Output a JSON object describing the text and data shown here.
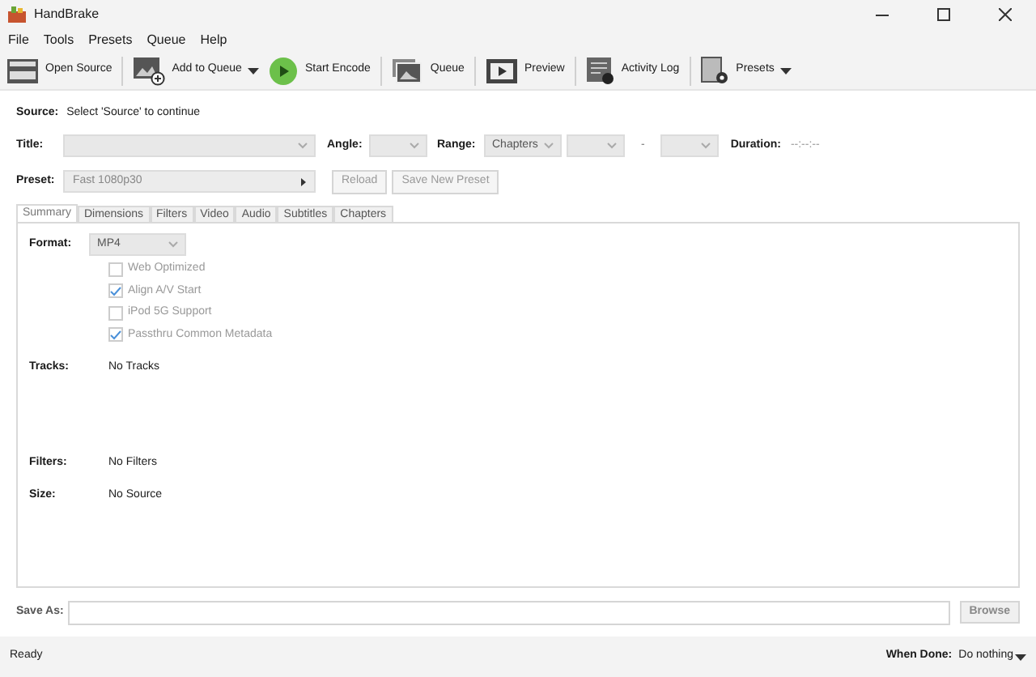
{
  "window": {
    "title": "HandBrake"
  },
  "menu": [
    "File",
    "Tools",
    "Presets",
    "Queue",
    "Help"
  ],
  "toolbar": [
    {
      "kind": "clapper",
      "label": "Open Source",
      "dropdown": false
    },
    {
      "kind": "add",
      "label": "Add to Queue",
      "dropdown": true
    },
    {
      "kind": "play",
      "label": "Start Encode",
      "dropdown": false
    },
    {
      "kind": "queue",
      "label": "Queue",
      "dropdown": false
    },
    {
      "kind": "film",
      "label": "Preview",
      "dropdown": false
    },
    {
      "kind": "log",
      "label": "Activity Log",
      "dropdown": false
    },
    {
      "kind": "presets",
      "label": "Presets",
      "dropdown": true
    }
  ],
  "source": {
    "label": "Source:",
    "value": "Select 'Source' to continue"
  },
  "title_row": {
    "title_label": "Title:",
    "angle_label": "Angle:",
    "range_label": "Range:",
    "range_value": "Chapters",
    "range_separator": "-",
    "duration_label": "Duration:",
    "duration_value": "--:--:--"
  },
  "preset": {
    "label": "Preset:",
    "value": "Fast 1080p30",
    "buttons": [
      "Reload",
      "Save New Preset"
    ]
  },
  "tabs": [
    {
      "label": "Summary",
      "selected": true
    },
    {
      "label": "Dimensions",
      "selected": false
    },
    {
      "label": "Filters",
      "selected": false
    },
    {
      "label": "Video",
      "selected": false
    },
    {
      "label": "Audio",
      "selected": false
    },
    {
      "label": "Subtitles",
      "selected": false
    },
    {
      "label": "Chapters",
      "selected": false
    }
  ],
  "summary": {
    "format_label": "Format:",
    "format_value": "MP4",
    "options": [
      {
        "label": "Web Optimized",
        "checked": false
      },
      {
        "label": "Align A/V Start",
        "checked": true
      },
      {
        "label": "iPod 5G Support",
        "checked": false
      },
      {
        "label": "Passthru Common Metadata",
        "checked": true
      }
    ],
    "tracks_label": "Tracks:",
    "tracks_value": "No Tracks",
    "filters_label": "Filters:",
    "filters_value": "No Filters",
    "size_label": "Size:",
    "size_value": "No Source"
  },
  "save_as": {
    "label": "Save As:",
    "button": "Browse"
  },
  "status_bar": {
    "status": "Ready",
    "when_done_label": "When Done:",
    "when_done_value": "Do nothing"
  }
}
